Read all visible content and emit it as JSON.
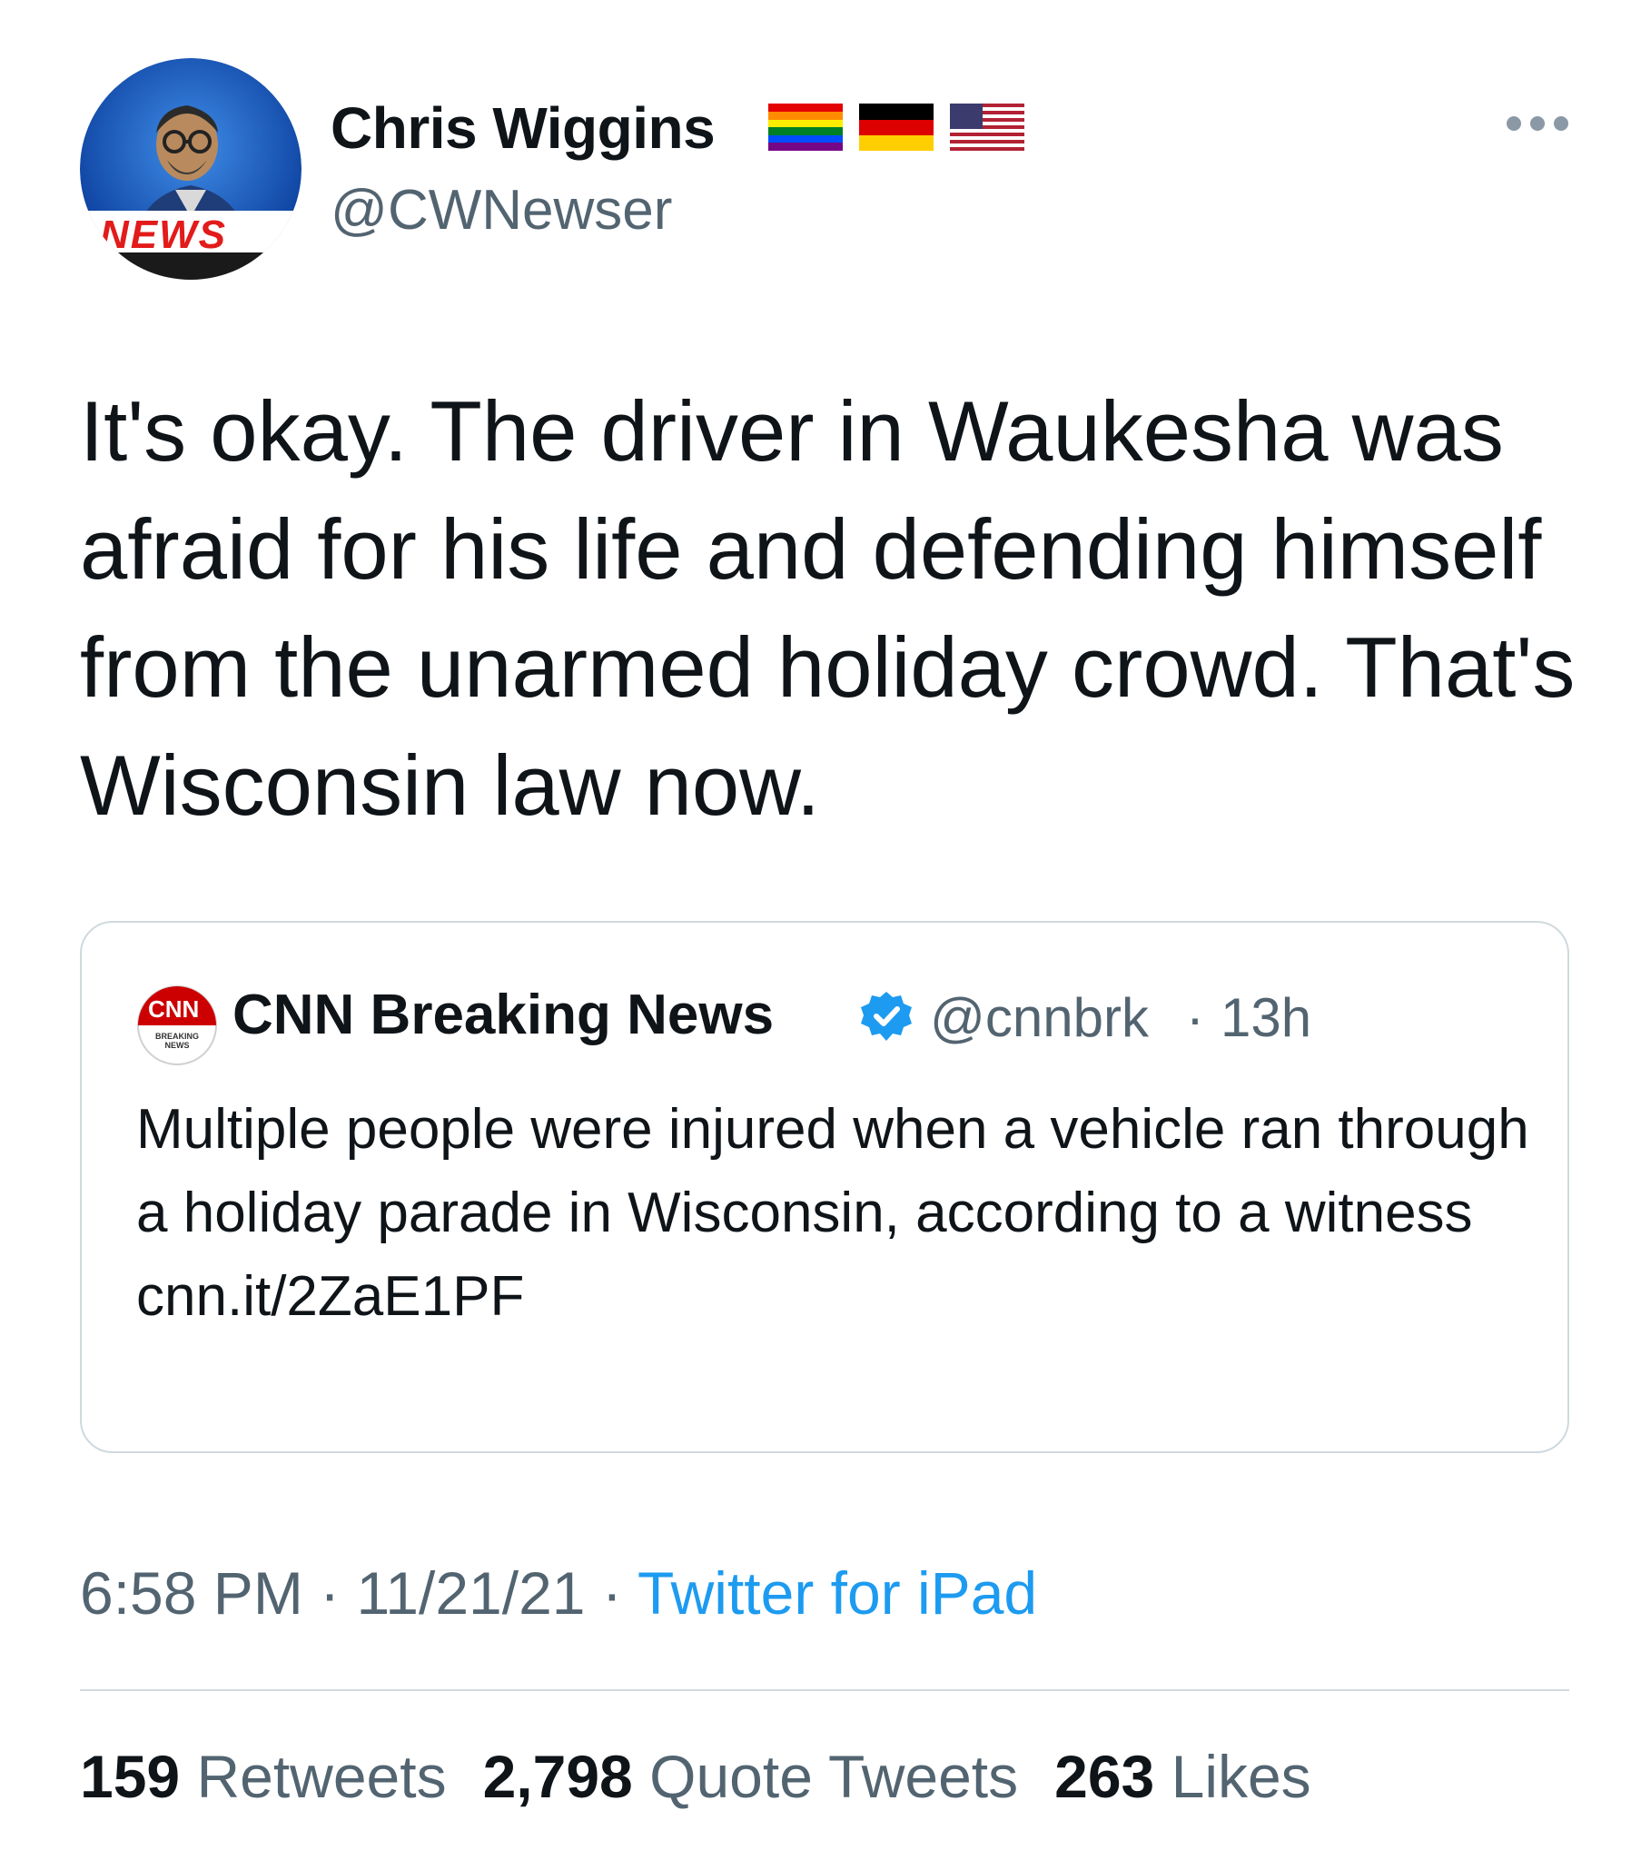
{
  "author": {
    "display_name": "Chris Wiggins",
    "handle": "@CWNewser",
    "avatar_badge_text": "NEWS",
    "flags": [
      "rainbow-flag-icon",
      "germany-flag-icon",
      "usa-flag-icon"
    ]
  },
  "tweet": {
    "text": "It's okay. The driver in Waukesha was afraid for his life and defending himself from the unarmed holiday crowd. That's Wisconsin law now."
  },
  "quote": {
    "logo_text": "CNN",
    "logo_subtext": "BREAKING NEWS",
    "display_name": "CNN Breaking News",
    "handle": "@cnnbrk",
    "separator": "·",
    "time": "13h",
    "text": "Multiple people were injured when a vehicle ran through a holiday parade in Wisconsin, according to a witness",
    "link": "cnn.it/2ZaE1PF"
  },
  "meta": {
    "time": "6:58 PM",
    "separator": "·",
    "date": "11/21/21",
    "source": "Twitter for iPad"
  },
  "stats": {
    "retweets_count": "159",
    "retweets_label": "Retweets",
    "quotes_count": "2,798",
    "quotes_label": "Quote Tweets",
    "likes_count": "263",
    "likes_label": "Likes"
  },
  "colors": {
    "text": "#0f1419",
    "secondary": "#536471",
    "accent": "#1d9bf0",
    "border": "#cfd9de",
    "cnn_red": "#cc0000"
  }
}
